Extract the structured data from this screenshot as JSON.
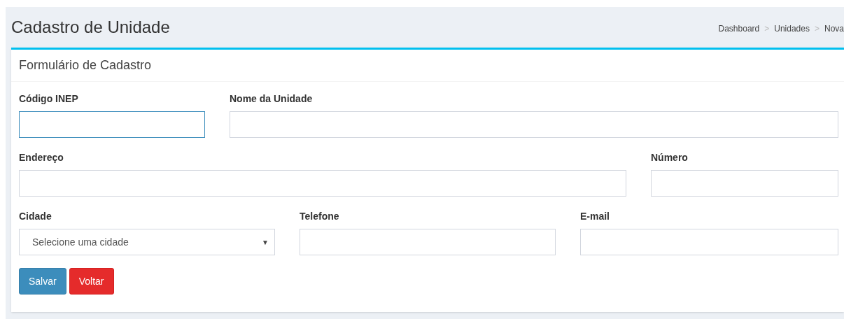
{
  "page_title": "Cadastro de Unidade",
  "breadcrumb": [
    {
      "label": "Dashboard"
    },
    {
      "label": "Unidades"
    },
    {
      "label": "Nova"
    }
  ],
  "breadcrumb_separator": ">",
  "card": {
    "title": "Formulário de Cadastro"
  },
  "rows": [
    [
      {
        "label": "Código INEP",
        "kind": "text",
        "focused": true
      },
      {
        "label": "Nome da Unidade",
        "kind": "text",
        "focused": false
      }
    ],
    [
      {
        "label": "Endereço",
        "kind": "text",
        "focused": false
      },
      {
        "label": "Número",
        "kind": "text",
        "focused": false
      }
    ],
    [
      {
        "label": "Cidade",
        "kind": "select",
        "focused": false,
        "value": "Selecione uma cidade",
        "arrow": "▼"
      },
      {
        "label": "Telefone",
        "kind": "text",
        "focused": false
      },
      {
        "label": "E-mail",
        "kind": "text",
        "focused": false
      }
    ]
  ],
  "buttons": [
    {
      "label": "Salvar",
      "kind": "primary"
    },
    {
      "label": "Voltar",
      "kind": "danger"
    }
  ]
}
